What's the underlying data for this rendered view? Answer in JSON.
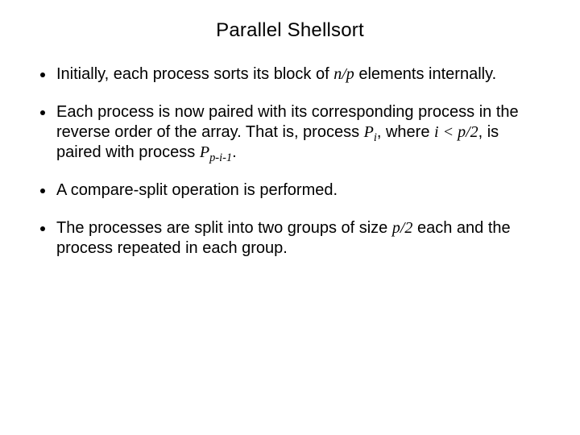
{
  "title": "Parallel Shellsort",
  "bullets": {
    "b1": {
      "t1": "Initially, each process sorts its block of ",
      "m1": "n/p",
      "t2": " elements internally."
    },
    "b2": {
      "t1": "Each process is now paired with its corresponding process in the reverse order of the array. That is, process ",
      "m1": "P",
      "m1sub": "i",
      "t2": ", where ",
      "m2": "i < p/2",
      "t3": ", is paired with process ",
      "m3": "P",
      "m3sub": "p-i-1",
      "t4": "."
    },
    "b3": {
      "t1": "A compare-split operation is performed."
    },
    "b4": {
      "t1": "The processes are split into two groups of size ",
      "m1": "p/2",
      "t2": " each and the process repeated in each group."
    }
  }
}
